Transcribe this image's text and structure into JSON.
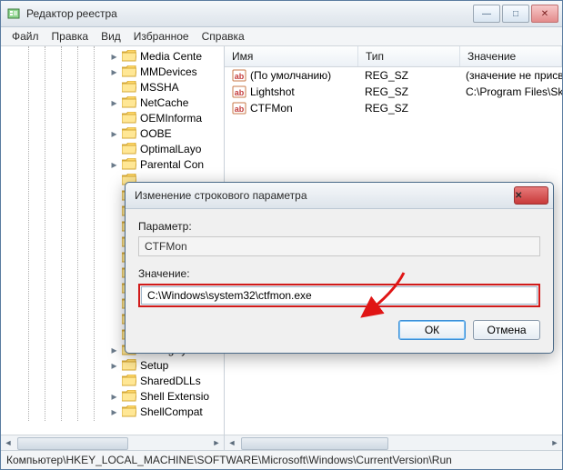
{
  "window": {
    "title": "Редактор реестра",
    "btn_min": "—",
    "btn_max": "□",
    "btn_close": "✕"
  },
  "menu": {
    "file": "Файл",
    "edit": "Правка",
    "view": "Вид",
    "favorites": "Избранное",
    "help": "Справка"
  },
  "tree": {
    "items": [
      {
        "label": "Media Cente",
        "expander": "▸"
      },
      {
        "label": "MMDevices",
        "expander": "▸"
      },
      {
        "label": "MSSHA",
        "expander": ""
      },
      {
        "label": "NetCache",
        "expander": "▸"
      },
      {
        "label": "OEMInforma",
        "expander": ""
      },
      {
        "label": "OOBE",
        "expander": "▸"
      },
      {
        "label": "OptimalLayo",
        "expander": ""
      },
      {
        "label": "Parental Con",
        "expander": "▸"
      },
      {
        "label": "",
        "expander": ""
      },
      {
        "label": "",
        "expander": ""
      },
      {
        "label": "",
        "expander": ""
      },
      {
        "label": "",
        "expander": ""
      },
      {
        "label": "",
        "expander": ""
      },
      {
        "label": "",
        "expander": ""
      },
      {
        "label": "",
        "expander": ""
      },
      {
        "label": "",
        "expander": ""
      },
      {
        "label": "",
        "expander": ""
      },
      {
        "label": "",
        "expander": ""
      },
      {
        "label": "",
        "expander": ""
      },
      {
        "label": "SettingSync",
        "expander": "▸"
      },
      {
        "label": "Setup",
        "expander": "▸"
      },
      {
        "label": "SharedDLLs",
        "expander": ""
      },
      {
        "label": "Shell Extensio",
        "expander": "▸"
      },
      {
        "label": "ShellCompat",
        "expander": "▸"
      }
    ]
  },
  "list": {
    "headers": {
      "name": "Имя",
      "type": "Тип",
      "value": "Значение"
    },
    "rows": [
      {
        "name": "(По умолчанию)",
        "type": "REG_SZ",
        "value": "(значение не присв"
      },
      {
        "name": "Lightshot",
        "type": "REG_SZ",
        "value": "C:\\Program Files\\Sk"
      },
      {
        "name": "CTFMon",
        "type": "REG_SZ",
        "value": ""
      }
    ]
  },
  "statusbar": {
    "path": "Компьютер\\HKEY_LOCAL_MACHINE\\SOFTWARE\\Microsoft\\Windows\\CurrentVersion\\Run"
  },
  "dialog": {
    "title": "Изменение строкового параметра",
    "param_label": "Параметр:",
    "param_value": "CTFMon",
    "value_label": "Значение:",
    "value_input": "C:\\Windows\\system32\\ctfmon.exe",
    "ok": "ОК",
    "cancel": "Отмена",
    "close": "✕"
  },
  "colors": {
    "highlight_red": "#d11a1a",
    "accent_blue": "#3d90d7"
  }
}
